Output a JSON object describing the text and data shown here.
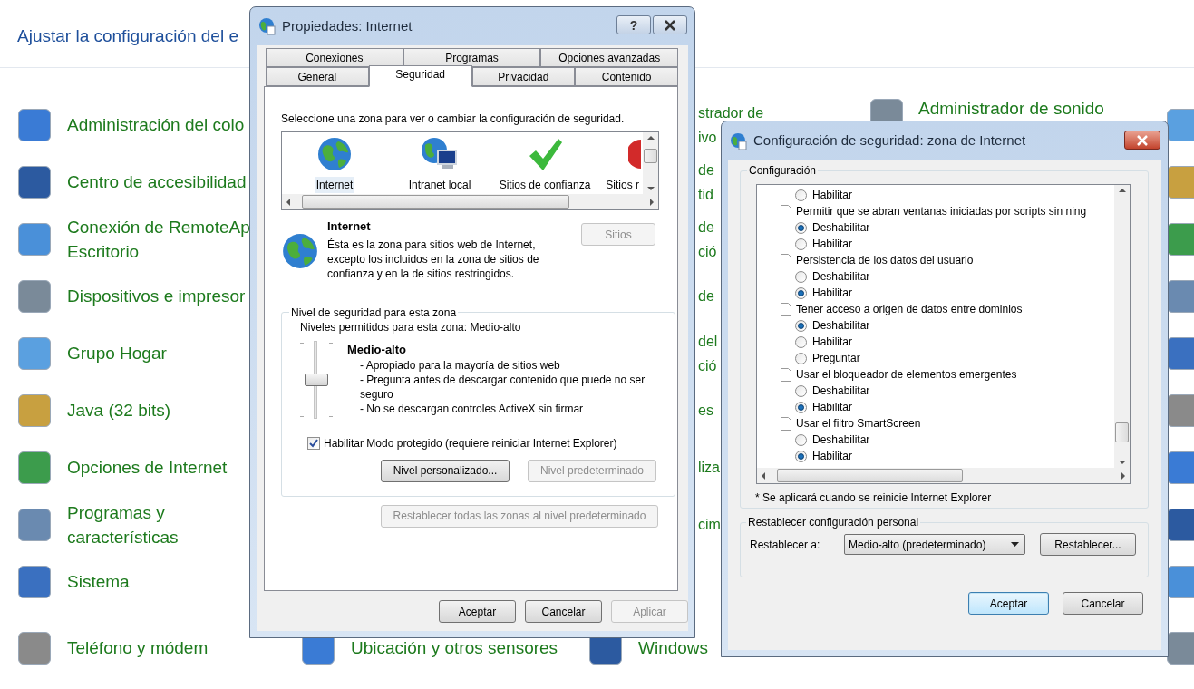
{
  "control_panel": {
    "header": "Ajustar la configuración del e",
    "rows": [
      {
        "col1": {
          "kind": "full",
          "lines": [
            "Administración del colo"
          ]
        },
        "col3": {
          "kind": "partial",
          "lines": [
            "strador de",
            "ivo"
          ]
        },
        "col4": {
          "kind": "top_line",
          "lines": [
            "Administrador de sonido"
          ]
        }
      },
      {
        "col1": {
          "kind": "full",
          "lines": [
            "Centro de accesibilidad"
          ]
        },
        "col3": {
          "kind": "partial",
          "lines": [
            "de",
            "tid"
          ]
        }
      },
      {
        "col1": {
          "kind": "full",
          "lines": [
            "Conexión de RemoteAp",
            "Escritorio"
          ]
        },
        "col3": {
          "kind": "partial",
          "lines": [
            "de",
            "ció"
          ]
        }
      },
      {
        "col1": {
          "kind": "full",
          "lines": [
            "Dispositivos e impresor"
          ]
        },
        "col3": {
          "kind": "partial",
          "lines": [
            "de"
          ]
        }
      },
      {
        "col1": {
          "kind": "full",
          "lines": [
            "Grupo Hogar"
          ]
        },
        "col3": {
          "kind": "partial",
          "lines": [
            "del",
            "ció"
          ]
        }
      },
      {
        "col1": {
          "kind": "full",
          "lines": [
            "Java (32 bits)"
          ]
        },
        "col3": {
          "kind": "partial",
          "lines": [
            "es"
          ]
        }
      },
      {
        "col1": {
          "kind": "full",
          "lines": [
            "Opciones de Internet"
          ]
        },
        "col3": {
          "kind": "partial",
          "lines": [
            "liza"
          ]
        }
      },
      {
        "col1": {
          "kind": "full",
          "lines": [
            "Programas y",
            "características"
          ]
        },
        "col3": {
          "kind": "partial",
          "lines": [
            "cim"
          ]
        }
      },
      {
        "col1": {
          "kind": "full",
          "lines": [
            "Sistema"
          ]
        }
      },
      {
        "col1": {
          "kind": "full",
          "lines": [
            "Teléfono y módem"
          ]
        },
        "col2": {
          "kind": "full",
          "lines": [
            "Ubicación y otros sensores"
          ]
        },
        "col3": {
          "kind": "full",
          "lines": [
            "Windows"
          ]
        }
      }
    ]
  },
  "internet_properties": {
    "title": "Propiedades: Internet",
    "help_button": "?",
    "tab_rows": [
      [
        {
          "label": "Conexiones",
          "selected": false
        },
        {
          "label": "Programas",
          "selected": false
        },
        {
          "label": "Opciones avanzadas",
          "selected": false
        }
      ],
      [
        {
          "label": "General",
          "selected": false
        },
        {
          "label": "Seguridad",
          "selected": true
        },
        {
          "label": "Privacidad",
          "selected": false
        },
        {
          "label": "Contenido",
          "selected": false
        }
      ]
    ],
    "zone_prompt": "Seleccione una zona para ver o cambiar la configuración de seguridad.",
    "zones": [
      {
        "kind": "globe",
        "label": "Internet",
        "selected": true
      },
      {
        "kind": "intranet",
        "label": "Intranet local",
        "selected": false
      },
      {
        "kind": "trusted",
        "label": "Sitios de confianza",
        "selected": false
      },
      {
        "kind": "restricted",
        "label": "Sitios r",
        "selected": false
      }
    ],
    "zone_name": "Internet",
    "zone_description": "Ésta es la zona para sitios web de Internet, excepto los incluidos en la zona de sitios de confianza y en la de sitios restringidos.",
    "sites_button": {
      "label": "Sitios",
      "disabled": true
    },
    "security_level": {
      "legend": "Nivel de seguridad para esta zona",
      "allowed": "Niveles permitidos para esta zona: Medio-alto",
      "level": 0.5,
      "level_name": "Medio-alto",
      "bullets": [
        "- Apropiado para la mayoría de sitios web",
        "- Pregunta antes de descargar contenido que puede no ser seguro",
        "- No se descargan controles ActiveX sin firmar"
      ],
      "protected_mode": {
        "label": "Habilitar Modo protegido (requiere reiniciar Internet Explorer)",
        "checked": true
      },
      "buttons": [
        {
          "label": "Nivel personalizado...",
          "disabled": false
        },
        {
          "label": "Nivel predeterminado",
          "disabled": true
        }
      ]
    },
    "reset_all_button": {
      "label": "Restablecer todas las zonas al nivel predeterminado",
      "disabled": true
    },
    "buttons": [
      {
        "label": "Aceptar",
        "disabled": false
      },
      {
        "label": "Cancelar",
        "disabled": false
      },
      {
        "label": "Aplicar",
        "disabled": true
      }
    ]
  },
  "security_settings": {
    "title": "Configuración de seguridad: zona de Internet",
    "settings_legend": "Configuración",
    "items": [
      {
        "kind": "option",
        "label": "Habilitar",
        "selected": false
      },
      {
        "kind": "setting",
        "label": "Permitir que se abran ventanas iniciadas por scripts sin ning"
      },
      {
        "kind": "option",
        "label": "Deshabilitar",
        "selected": true
      },
      {
        "kind": "option",
        "label": "Habilitar",
        "selected": false
      },
      {
        "kind": "setting",
        "label": "Persistencia de los datos del usuario"
      },
      {
        "kind": "option",
        "label": "Deshabilitar",
        "selected": false
      },
      {
        "kind": "option",
        "label": "Habilitar",
        "selected": true
      },
      {
        "kind": "setting",
        "label": "Tener acceso a origen de datos entre dominios"
      },
      {
        "kind": "option",
        "label": "Deshabilitar",
        "selected": true
      },
      {
        "kind": "option",
        "label": "Habilitar",
        "selected": false
      },
      {
        "kind": "option",
        "label": "Preguntar",
        "selected": false
      },
      {
        "kind": "setting",
        "label": "Usar el bloqueador de elementos emergentes"
      },
      {
        "kind": "option",
        "label": "Deshabilitar",
        "selected": false
      },
      {
        "kind": "option",
        "label": "Habilitar",
        "selected": true
      },
      {
        "kind": "setting",
        "label": "Usar el filtro SmartScreen"
      },
      {
        "kind": "option",
        "label": "Deshabilitar",
        "selected": false
      },
      {
        "kind": "option",
        "label": "Habilitar",
        "selected": true
      }
    ],
    "footnote": "* Se aplicará cuando se reinicie Internet Explorer",
    "reset_legend": "Restablecer configuración personal",
    "reset_label": "Restablecer a:",
    "reset_value": "Medio-alto (predeterminado)",
    "reset_button": "Restablecer...",
    "buttons": [
      {
        "label": "Aceptar",
        "default": true
      },
      {
        "label": "Cancelar",
        "default": false
      }
    ]
  }
}
